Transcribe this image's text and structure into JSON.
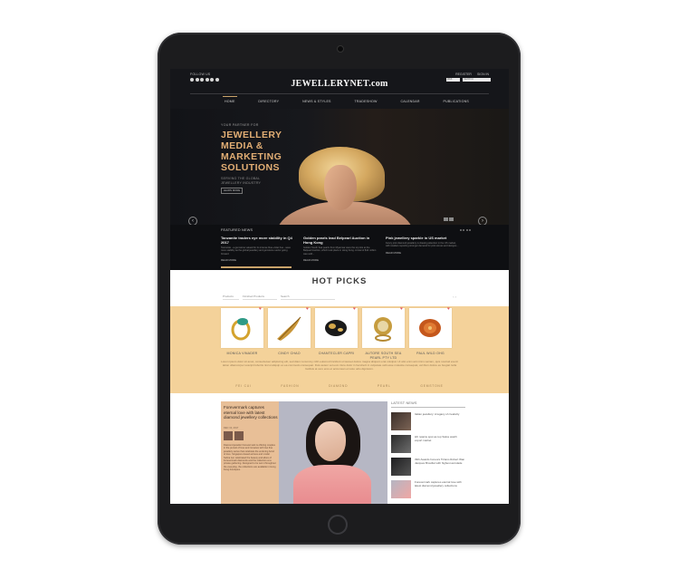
{
  "header": {
    "follow_label": "FOLLOW US",
    "logo": "JEWELLERYNET.com",
    "register": "REGISTER",
    "signin": "SIGN IN",
    "select_value": "Web",
    "search_placeholder": "SEARCH"
  },
  "nav": [
    "HOME",
    "DIRECTORY",
    "NEWS & STYLES",
    "TRADESHOW",
    "CALENDAR",
    "PUBLICATIONS"
  ],
  "hero": {
    "tagline": "YOUR PARTNER FOR",
    "headline_lines": [
      "JEWELLERY",
      "MEDIA &",
      "MARKETING",
      "SOLUTIONS"
    ],
    "sub_lines": [
      "SERVING THE GLOBAL",
      "JEWELLERY INDUSTRY"
    ],
    "button": "LEARN MORE",
    "arrow_left": "‹",
    "arrow_right": "›"
  },
  "featured_news": {
    "label": "FEATURED NEWS",
    "items": [
      {
        "title": "Tanzanite traders eye more stability in Q4 2017",
        "body": "Tanzanite - a gemstone valued for its intense blue-violet hue - sees more stability as the global jewellery and gemstone sector going forward",
        "more": "READ MORE"
      },
      {
        "title": "Golden pearls lead Belpearl Auction in Hong Kong",
        "body": "Golden South Sea pearls from Myanmar were the top lots at the Belpearl Auction, which took place in Hong Kong. A total of $14 million was sold...",
        "more": "READ MORE"
      },
      {
        "title": "Pink jewellery sparkle in US market",
        "body": "Fancy pink diamond jewellery is drawing attention in the US market, with retailers reporting stronger demand for pink stones and designs...",
        "more": "READ MORE"
      }
    ]
  },
  "hot_picks": {
    "title": "HOT PICKS",
    "filters": [
      "Products",
      "Finished Products",
      "Search"
    ],
    "items": [
      {
        "name": "MONICA VINADER"
      },
      {
        "name": "CINDY CHAO"
      },
      {
        "name": "CHANTECLER CAPRI"
      },
      {
        "name": "AUTORE SOUTH SEA PEARL PTY LTD"
      },
      {
        "name": "PAUL WILD OHG"
      }
    ],
    "description": "Lorem ipsum dolor sit amet, consectetuer adipiscing elit, sed diam nonummy nibh euismod tincidunt ut laoreet dolore magna aliquam erat volutpat. Ut wisi enim ad minim veniam, quis nostrud exerci tation ullamcorper suscipit lobortis nisl ut aliquip ex ea commodo consequat. Duis autem vel eum iriure dolor in hendrerit in vulputate velit esse molestie consequat, vel illum dolore eu feugiat nulla facilisis at vero eros et accumsan et iusto odio dignissim.",
    "categories": [
      "FEI CUI",
      "FASHION",
      "DIAMOND",
      "PEARL",
      "GEMSTONE"
    ]
  },
  "feature_story": {
    "title": "Forevermark captures eternal love with latest diamond jewellery collections",
    "date": "DEC 13, 2017",
    "body": "Diamond jeweller Forevermark is offering couples in the pursuit of love and romance with two fine jewellery series that celebrate the enduring bond of love. Singapore-based actress and model Selina Jen celebrated the beauty and allure of Forevermark diamonds and the collection at a private gathering. Designed to be worn throughout the everyday, the collections are available in Hong Kong boutiques."
  },
  "latest_news": {
    "label": "LATEST NEWS",
    "items": [
      {
        "title": "Italian jewellery: A legacy of creativity"
      },
      {
        "title": "HK retains spot as top Swiss watch export market"
      },
      {
        "title": "39th Awards honours Tiziano Robert Wan Jacques Brouillet with highest accolade"
      },
      {
        "title": "Forevermark captures eternal love with latest diamond jewellery collections"
      }
    ]
  },
  "colors": {
    "accent_gold": "#e2ae74",
    "band": "#f4d29a",
    "dark": "#15161a"
  }
}
